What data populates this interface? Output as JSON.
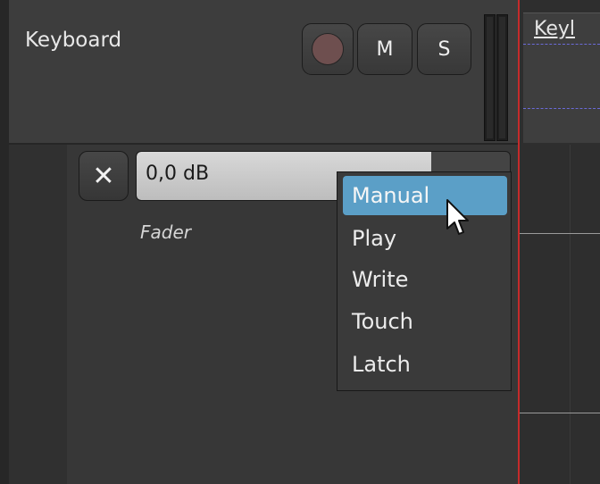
{
  "track": {
    "name": "Keyboard",
    "buttons": {
      "mute": "M",
      "solo": "S"
    }
  },
  "region": {
    "label": "Keyl"
  },
  "automation": {
    "close_label": "✕",
    "gain_value": "0,0 dB",
    "gain_level": 0.79,
    "lane_label": "Fader"
  },
  "menu": {
    "items": [
      "Manual",
      "Play",
      "Write",
      "Touch",
      "Latch"
    ],
    "highlighted": "Manual"
  },
  "colors": {
    "playhead": "#c62b2b",
    "menu_highlight": "#5b9fc7",
    "record_button": "#6e4f4f"
  }
}
